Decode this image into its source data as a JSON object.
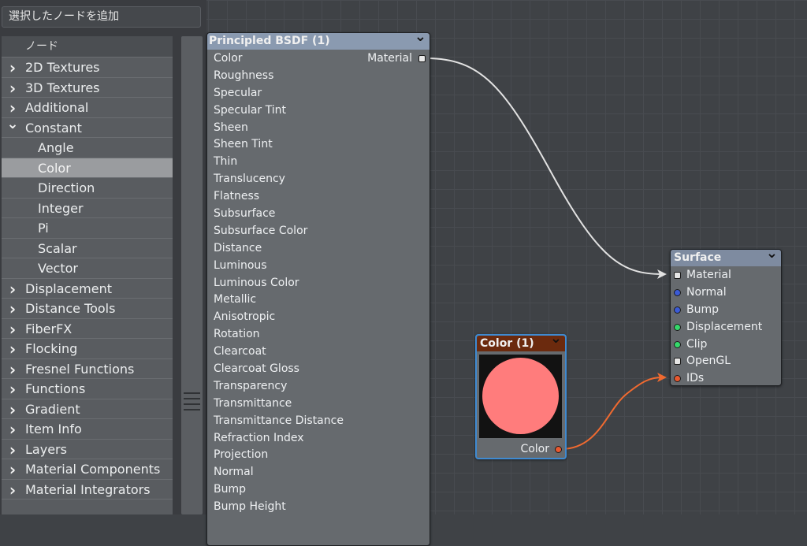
{
  "search_label": "選択したノードを追加",
  "tree": {
    "header": "ノード",
    "items": [
      {
        "label": "2D Textures",
        "chev": "❯",
        "child": false,
        "selected": false
      },
      {
        "label": "3D Textures",
        "chev": "❯",
        "child": false,
        "selected": false
      },
      {
        "label": "Additional",
        "chev": "❯",
        "child": false,
        "selected": false
      },
      {
        "label": "Constant",
        "chev": "❯",
        "child": false,
        "selected": false,
        "expanded": true
      },
      {
        "label": "Angle",
        "chev": "",
        "child": true,
        "selected": false
      },
      {
        "label": "Color",
        "chev": "",
        "child": true,
        "selected": true
      },
      {
        "label": "Direction",
        "chev": "",
        "child": true,
        "selected": false
      },
      {
        "label": "Integer",
        "chev": "",
        "child": true,
        "selected": false
      },
      {
        "label": "Pi",
        "chev": "",
        "child": true,
        "selected": false
      },
      {
        "label": "Scalar",
        "chev": "",
        "child": true,
        "selected": false
      },
      {
        "label": "Vector",
        "chev": "",
        "child": true,
        "selected": false
      },
      {
        "label": "Displacement",
        "chev": "❯",
        "child": false,
        "selected": false
      },
      {
        "label": "Distance Tools",
        "chev": "❯",
        "child": false,
        "selected": false
      },
      {
        "label": "FiberFX",
        "chev": "❯",
        "child": false,
        "selected": false
      },
      {
        "label": "Flocking",
        "chev": "❯",
        "child": false,
        "selected": false
      },
      {
        "label": "Fresnel Functions",
        "chev": "❯",
        "child": false,
        "selected": false
      },
      {
        "label": "Functions",
        "chev": "❯",
        "child": false,
        "selected": false
      },
      {
        "label": "Gradient",
        "chev": "❯",
        "child": false,
        "selected": false
      },
      {
        "label": "Item Info",
        "chev": "❯",
        "child": false,
        "selected": false
      },
      {
        "label": "Layers",
        "chev": "❯",
        "child": false,
        "selected": false
      },
      {
        "label": "Material Components",
        "chev": "❯",
        "child": false,
        "selected": false
      },
      {
        "label": "Material Integrators",
        "chev": "❯",
        "child": false,
        "selected": false
      }
    ]
  },
  "bsdf_node": {
    "title": "Principled BSDF (1)",
    "output_label": "Material",
    "inputs": [
      "Color",
      "Roughness",
      "Specular",
      "Specular Tint",
      "Sheen",
      "Sheen Tint",
      "Thin",
      "Translucency",
      "Flatness",
      "Subsurface",
      "Subsurface Color",
      "Distance",
      "Luminous",
      "Luminous Color",
      "Metallic",
      "Anisotropic",
      "Rotation",
      "Clearcoat",
      "Clearcoat Gloss",
      "Transparency",
      "Transmittance",
      "Transmittance Distance",
      "Refraction Index",
      "Projection",
      "Normal",
      "Bump",
      "Bump Height"
    ]
  },
  "surface_node": {
    "title": "Surface",
    "inputs": [
      {
        "label": "Material",
        "color": "#e6e6e6"
      },
      {
        "label": "Normal",
        "color": "#3b5bd6"
      },
      {
        "label": "Bump",
        "color": "#3b5bd6"
      },
      {
        "label": "Displacement",
        "color": "#35d96b"
      },
      {
        "label": "Clip",
        "color": "#35d96b"
      },
      {
        "label": "OpenGL",
        "color": "#e6e6e6"
      },
      {
        "label": "IDs",
        "color": "#e8582f"
      }
    ]
  },
  "color_node": {
    "title": "Color (1)",
    "output_label": "Color",
    "output_color": "#e8582f",
    "swatch_color": "#ff7c7c"
  },
  "colors": {
    "wire_material": "#e2e2e2",
    "wire_color": "#f06a30"
  }
}
